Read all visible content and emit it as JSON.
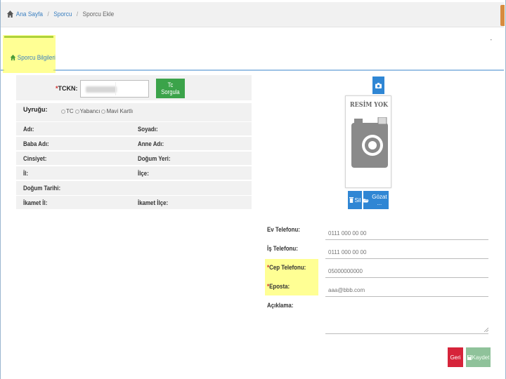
{
  "breadcrumb": {
    "home": "Ana Sayfa",
    "level1": "Sporcu",
    "current": "Sporcu Ekle",
    "separator": "/"
  },
  "tab": {
    "label": "Sporcu Bilgileri",
    "icon": "home-icon"
  },
  "header_mark": "-",
  "identity": {
    "tckn_label": "TCKN:",
    "required_mark": "*",
    "query_button": "Tc Sorgula",
    "nationality_label": "Uyruğu:",
    "nationality_options": [
      "TC",
      "Yabancı",
      "Mavi Kartlı"
    ]
  },
  "fields": [
    {
      "left": "Adı:",
      "right": "Soyadı:"
    },
    {
      "left": "Baba Adı:",
      "right": "Anne Adı:"
    },
    {
      "left": "Cinsiyet:",
      "right": "Doğum Yeri:"
    },
    {
      "left": "İl:",
      "right": "İlçe:"
    },
    {
      "left": "Doğum Tarihi:",
      "right": ""
    },
    {
      "left": "İkamet İl:",
      "right": "İkamet İlçe:"
    }
  ],
  "photo": {
    "placeholder_text": "RESİM YOK",
    "camera_icon": "camera-icon",
    "delete_button": "Sil",
    "browse_button": "Gözat ..."
  },
  "contact": {
    "home_phone": {
      "label": "Ev Telefonu:",
      "placeholder": "0111 000 00 00"
    },
    "work_phone": {
      "label": "İş Telefonu:",
      "placeholder": "0111 000 00 00"
    },
    "mobile_phone": {
      "label": "Cep Telefonu:",
      "placeholder": "05000000000"
    },
    "email": {
      "label": "Eposta:",
      "placeholder": "aaa@bbb.com"
    },
    "description": {
      "label": "Açıklama:"
    }
  },
  "actions": {
    "back": "Geri",
    "save": "Kaydet"
  },
  "colors": {
    "accent_blue": "#2f86d4",
    "green": "#3ba34a",
    "red": "#d6243a",
    "save_disabled": "#8fc29a",
    "highlight": "#ffff3c"
  }
}
